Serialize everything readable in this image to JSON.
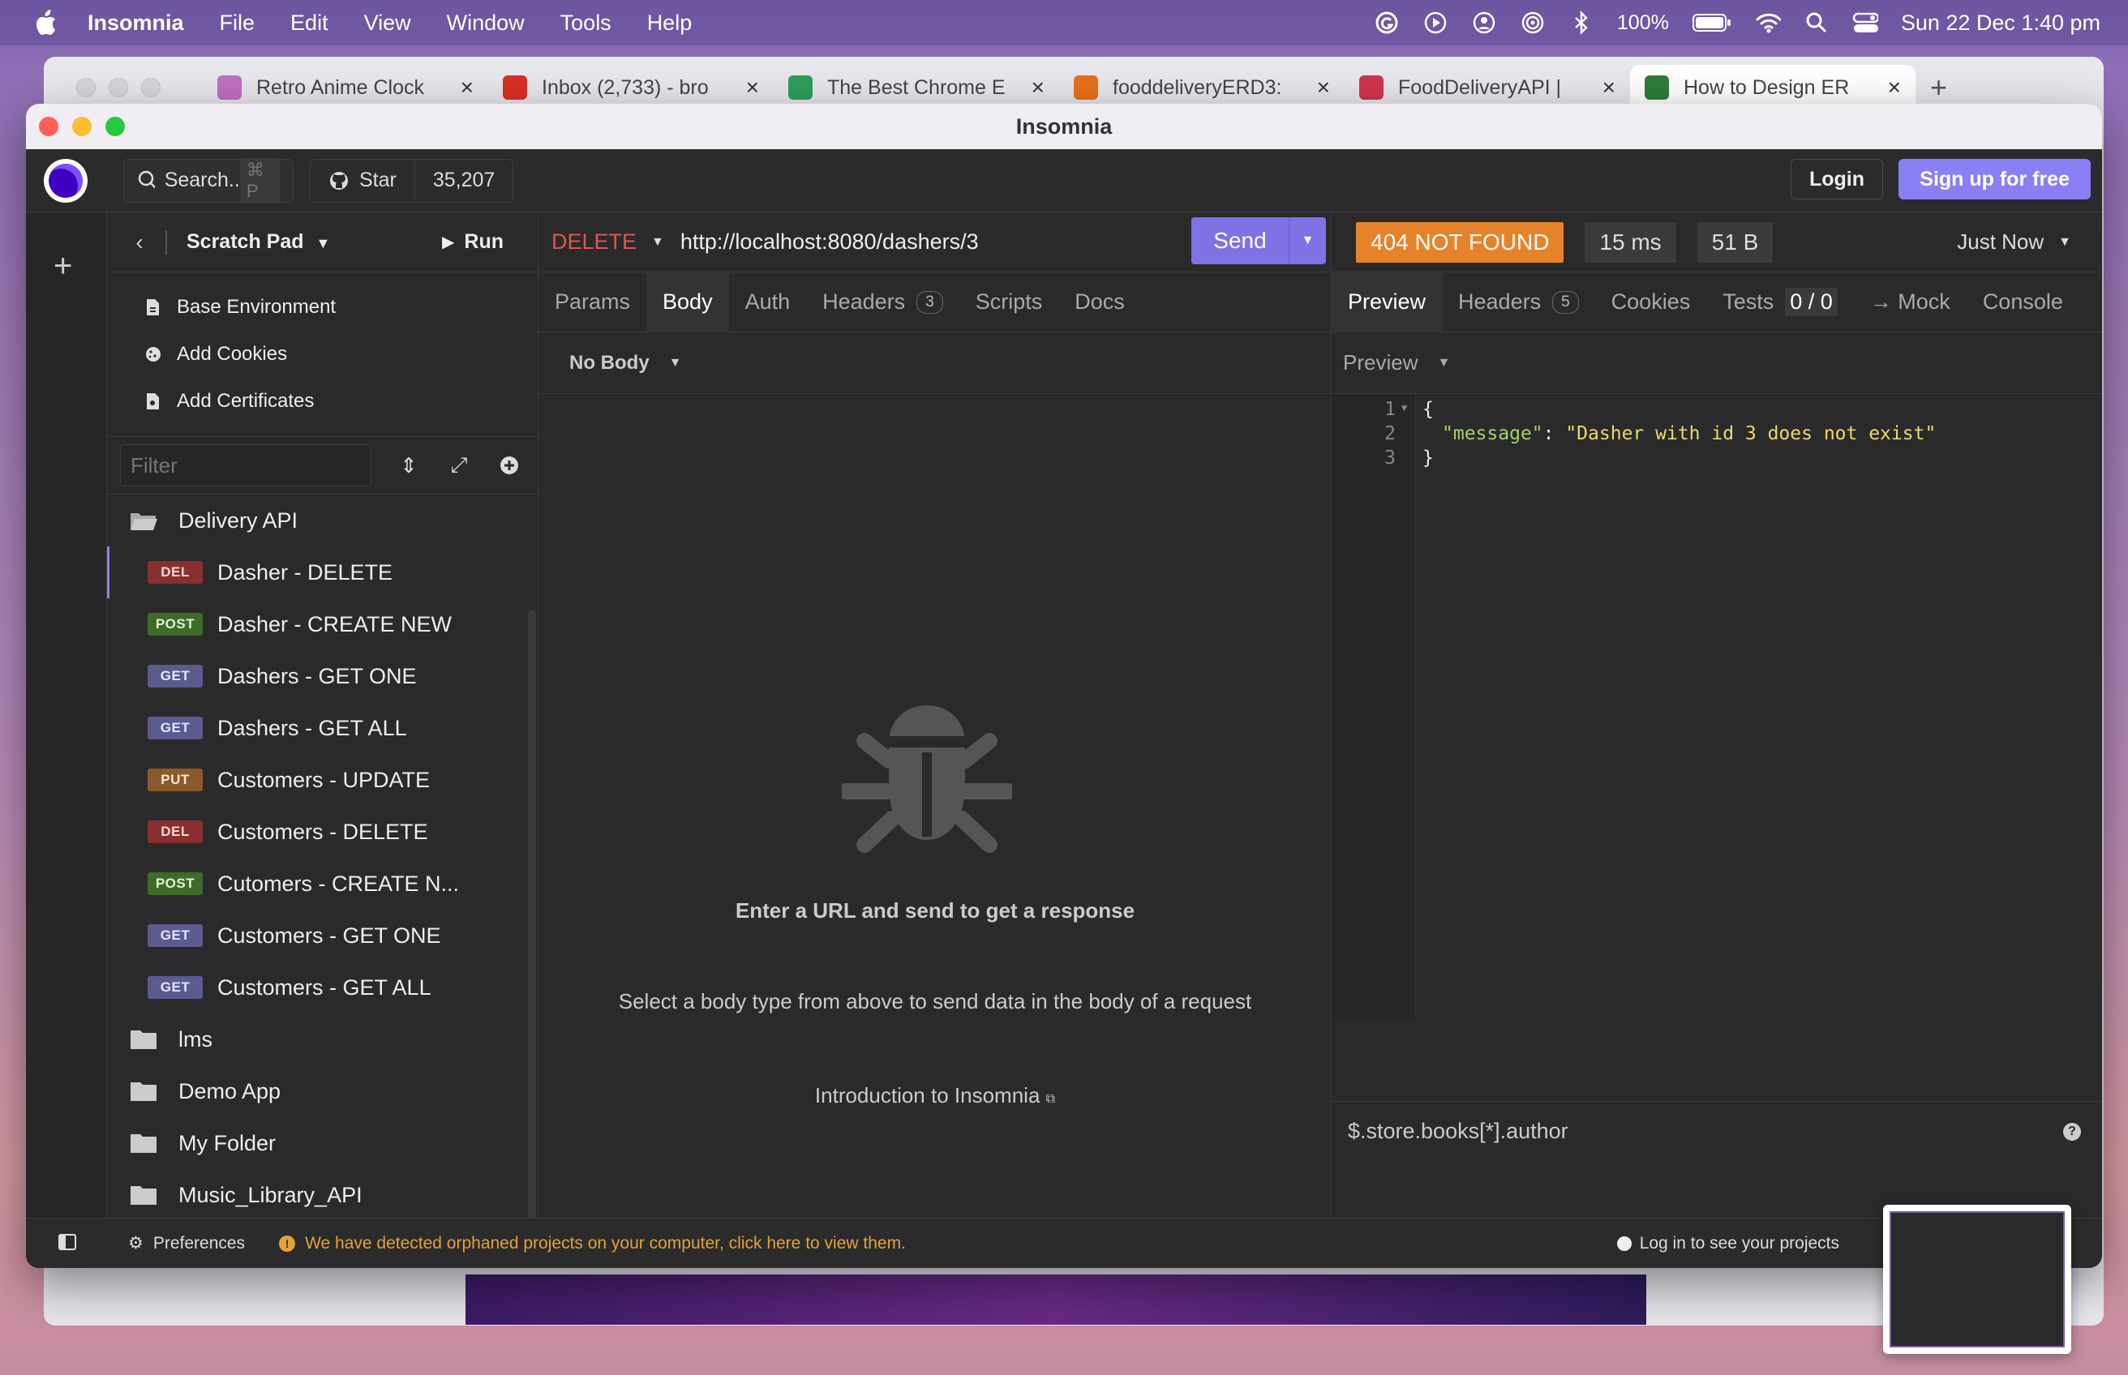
{
  "menubar": {
    "app": "Insomnia",
    "items": [
      "File",
      "Edit",
      "View",
      "Window",
      "Tools",
      "Help"
    ],
    "battery": "100%",
    "datetime": "Sun 22 Dec  1:40 pm"
  },
  "browser": {
    "tabs": [
      {
        "title": "Retro Anime Clock",
        "color": "#c070c0"
      },
      {
        "title": "Inbox (2,733) - bro",
        "color": "#d93025"
      },
      {
        "title": "The Best Chrome E",
        "color": "#2f9e5b"
      },
      {
        "title": "fooddeliveryERD3:",
        "color": "#e8711c"
      },
      {
        "title": "FoodDeliveryAPI |",
        "color": "#d0344f"
      },
      {
        "title": "How to Design ER",
        "color": "#2f7d3a"
      }
    ]
  },
  "window": {
    "title": "Insomnia"
  },
  "topbar": {
    "search_label": "Search..",
    "search_shortcut": "⌘ P",
    "star_label": "Star",
    "star_count": "35,207",
    "login": "Login",
    "signup": "Sign up for free"
  },
  "sidebar": {
    "project": "Scratch Pad",
    "run": "Run",
    "env_items": [
      "Base Environment",
      "Add Cookies",
      "Add Certificates"
    ],
    "filter_placeholder": "Filter",
    "folder_open": "Delivery API",
    "requests": [
      {
        "method": "DEL",
        "name": "Dasher - DELETE",
        "cls": "m-del",
        "selected": true
      },
      {
        "method": "POST",
        "name": "Dasher - CREATE NEW",
        "cls": "m-post"
      },
      {
        "method": "GET",
        "name": "Dashers - GET ONE",
        "cls": "m-get"
      },
      {
        "method": "GET",
        "name": "Dashers - GET ALL",
        "cls": "m-get"
      },
      {
        "method": "PUT",
        "name": "Customers - UPDATE",
        "cls": "m-put"
      },
      {
        "method": "DEL",
        "name": "Customers - DELETE",
        "cls": "m-del"
      },
      {
        "method": "POST",
        "name": "Cutomers - CREATE N...",
        "cls": "m-post"
      },
      {
        "method": "GET",
        "name": "Customers - GET ONE",
        "cls": "m-get"
      },
      {
        "method": "GET",
        "name": "Customers - GET ALL",
        "cls": "m-get"
      }
    ],
    "folders": [
      "lms",
      "Demo App",
      "My Folder",
      "Music_Library_API"
    ]
  },
  "request": {
    "method": "DELETE",
    "url": "http://localhost:8080/dashers/3",
    "send": "Send",
    "tabs": [
      "Params",
      "Body",
      "Auth",
      "Headers",
      "Scripts",
      "Docs"
    ],
    "headers_count": "3",
    "body_type": "No Body",
    "empty_title": "Enter a URL and send to get a response",
    "empty_desc": "Select a body type from above to send data in the body of a request",
    "intro_link": "Introduction to Insomnia"
  },
  "response": {
    "status": "404 NOT FOUND",
    "time": "15 ms",
    "size": "51 B",
    "when": "Just Now",
    "tabs": {
      "preview": "Preview",
      "headers": "Headers",
      "headers_count": "5",
      "cookies": "Cookies",
      "tests": "Tests",
      "tests_count": "0 / 0",
      "mock": "→ Mock",
      "console": "Console"
    },
    "preview_mode": "Preview",
    "lines": [
      "1",
      "2",
      "3"
    ],
    "json_open": "{",
    "json_key": "\"message\"",
    "json_colon": ": ",
    "json_value": "\"Dasher with id 3 does not exist\"",
    "json_close": "}",
    "jsonpath": "$.store.books[*].author"
  },
  "statusbar": {
    "preferences": "Preferences",
    "warning": "We have detected orphaned projects on your computer, click here to view them.",
    "login_projects": "Log in to see your projects"
  }
}
